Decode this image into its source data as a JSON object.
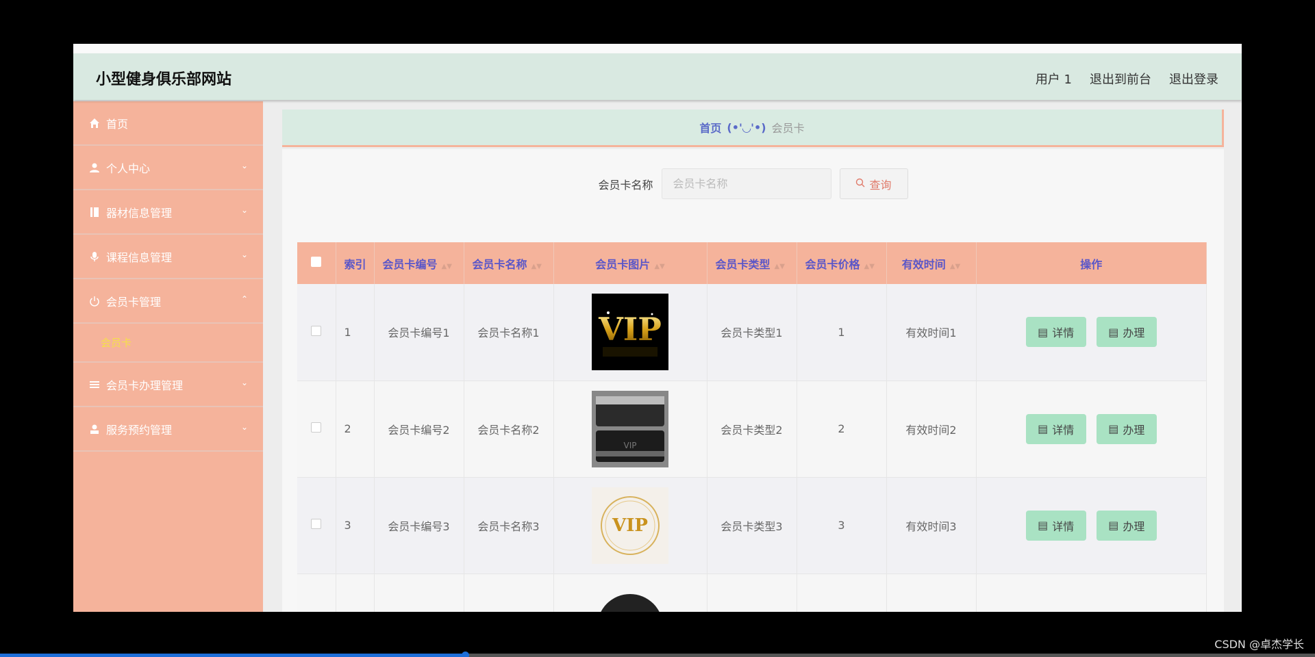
{
  "header": {
    "title": "小型健身俱乐部网站",
    "user": "用户 1",
    "exit_front": "退出到前台",
    "logout": "退出登录"
  },
  "sidebar": {
    "items": [
      {
        "label": "首页",
        "icon": "home-icon",
        "chevron": false
      },
      {
        "label": "个人中心",
        "icon": "user-icon",
        "chevron": true
      },
      {
        "label": "器材信息管理",
        "icon": "book-icon",
        "chevron": true
      },
      {
        "label": "课程信息管理",
        "icon": "mic-icon",
        "chevron": true
      },
      {
        "label": "会员卡管理",
        "icon": "power-icon",
        "chevron": true,
        "expanded": true
      },
      {
        "label": "会员卡办理管理",
        "icon": "list-icon",
        "chevron": true
      },
      {
        "label": "服务预约管理",
        "icon": "stamp-icon",
        "chevron": true
      }
    ],
    "submenu_active": "会员卡"
  },
  "breadcrumb": {
    "home": "首页",
    "face": "(•'◡'•)",
    "current": "会员卡"
  },
  "search": {
    "label": "会员卡名称",
    "placeholder": "会员卡名称",
    "button": "查询"
  },
  "table": {
    "headers": [
      "索引",
      "会员卡编号",
      "会员卡名称",
      "会员卡图片",
      "会员卡类型",
      "会员卡价格",
      "有效时间",
      "操作"
    ],
    "rows": [
      {
        "index": "1",
        "code": "会员卡编号1",
        "name": "会员卡名称1",
        "type": "会员卡类型1",
        "price": "1",
        "valid": "有效时间1"
      },
      {
        "index": "2",
        "code": "会员卡编号2",
        "name": "会员卡名称2",
        "type": "会员卡类型2",
        "price": "2",
        "valid": "有效时间2"
      },
      {
        "index": "3",
        "code": "会员卡编号3",
        "name": "会员卡名称3",
        "type": "会员卡类型3",
        "price": "3",
        "valid": "有效时间3"
      }
    ],
    "detail_label": "详情",
    "handle_label": "办理",
    "vip_text": "VIP"
  },
  "watermark": "CSDN @卓杰学长",
  "colors": {
    "sidebar": "#f5b39b",
    "header": "#d9e9e1",
    "accent_text": "#5a56c8",
    "action_button": "#a9e2c3"
  }
}
